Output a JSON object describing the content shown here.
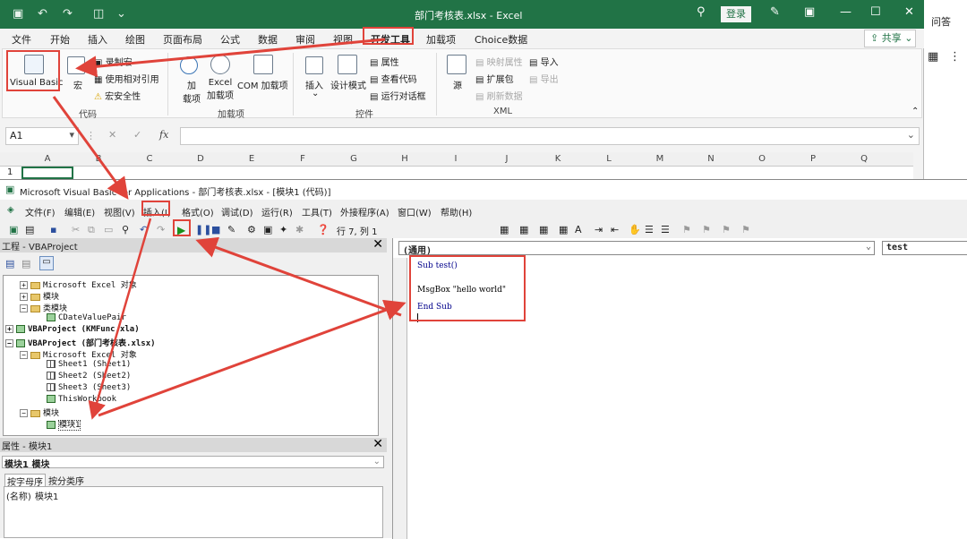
{
  "excel": {
    "title": "部门考核表.xlsx - Excel",
    "login_label": "登录",
    "tabs": [
      "文件",
      "开始",
      "插入",
      "绘图",
      "页面布局",
      "公式",
      "数据",
      "审阅",
      "视图",
      "开发工具",
      "加载项",
      "Choice数据"
    ],
    "share_label": "共享",
    "ribbon": {
      "vb_label": "Visual Basic",
      "macro_label": "宏",
      "record_macro": "录制宏",
      "relative_ref": "使用相对引用",
      "macro_security": "宏安全性",
      "group_code": "代码",
      "addins_label": "加\n载项",
      "excel_addins": "Excel\n加载项",
      "com_addins": "COM 加载项",
      "group_addins": "加载项",
      "insert_label": "插入",
      "design_mode": "设计模式",
      "properties": "属性",
      "view_code": "查看代码",
      "run_dialog": "运行对话框",
      "group_controls": "控件",
      "source_label": "源",
      "map_props": "映射属性",
      "ext_pack": "扩展包",
      "refresh_data": "刷新数据",
      "import": "导入",
      "export": "导出",
      "group_xml": "XML"
    },
    "name_box": "A1",
    "fx_label": "fx",
    "columns": [
      "A",
      "B",
      "C",
      "D",
      "E",
      "F",
      "G",
      "H",
      "I",
      "J",
      "K",
      "L",
      "M",
      "N",
      "O",
      "P",
      "Q"
    ],
    "row_label": "1",
    "side_text": "问答"
  },
  "vba": {
    "title": "Microsoft Visual Basic for Applications - 部门考核表.xlsx - [模块1 (代码)]",
    "menus": [
      "文件(F)",
      "编辑(E)",
      "视图(V)",
      "插入(I)",
      "格式(O)",
      "调试(D)",
      "运行(R)",
      "工具(T)",
      "外接程序(A)",
      "窗口(W)",
      "帮助(H)"
    ],
    "cursor_pos": "行 7, 列 1",
    "project_title": "工程 - VBAProject",
    "tree": [
      {
        "text": "Microsoft Excel 对象",
        "bold": false
      },
      {
        "text": "模块",
        "bold": false
      },
      {
        "text": "类模块",
        "bold": false
      },
      {
        "text": "CDateValuePair",
        "bold": false
      },
      {
        "text": "VBAProject (KMFunc.xla)",
        "bold": true
      },
      {
        "text": "VBAProject (部门考核表.xlsx)",
        "bold": true
      },
      {
        "text": "Microsoft Excel 对象",
        "bold": false
      },
      {
        "text": "Sheet1 (Sheet1)",
        "bold": false
      },
      {
        "text": "Sheet2 (Sheet2)",
        "bold": false
      },
      {
        "text": "Sheet3 (Sheet3)",
        "bold": false
      },
      {
        "text": "ThisWorkbook",
        "bold": false
      },
      {
        "text": "模块",
        "bold": false
      },
      {
        "text": "模块1",
        "bold": false
      }
    ],
    "props_title": "属性 - 模块1",
    "props_select": "模块1 模块",
    "props_tab_alpha": "按字母序",
    "props_tab_cat": "按分类序",
    "prop_name_key": "(名称)",
    "prop_name_val": "模块1",
    "code_combo_left": "(通用)",
    "code_combo_right": "test",
    "code": {
      "line1": "Sub test()",
      "line2": "MsgBox \"hello world\"",
      "line3": "End Sub"
    }
  },
  "colors": {
    "excel_green": "#217346",
    "highlight_red": "#e0433a"
  }
}
